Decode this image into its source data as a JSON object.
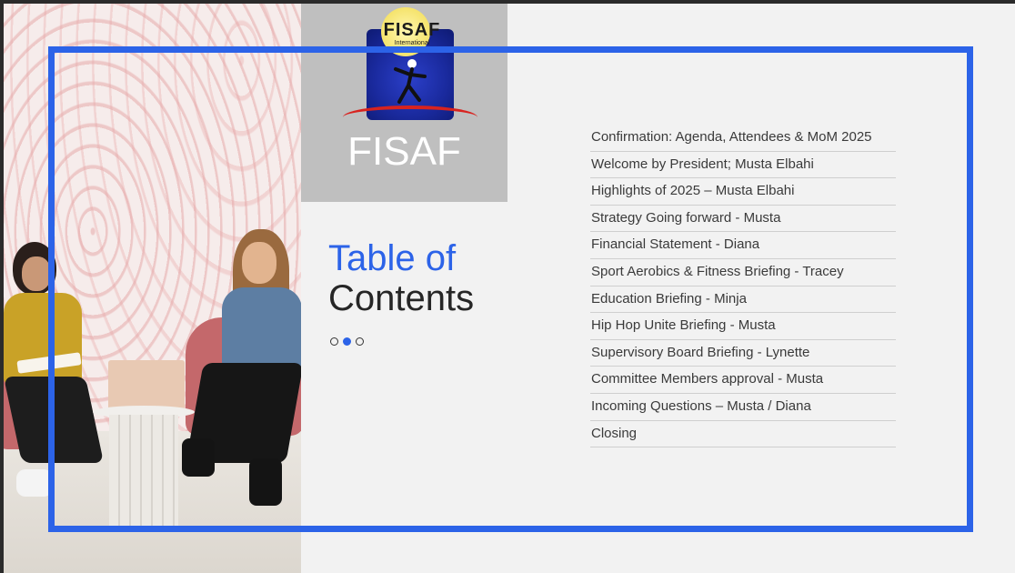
{
  "logo": {
    "emblem_text": "FISAF",
    "emblem_subtext": "International",
    "title": "FISAF",
    "colors": {
      "emblem_blue": "#1a2a9e",
      "sun": "#f5e36c",
      "swoosh": "#d8231f",
      "block_bg": "#bfbfbf"
    }
  },
  "heading": {
    "line1": "Table of",
    "line2": "Contents"
  },
  "pager": {
    "count": 3,
    "active_index": 1
  },
  "agenda": [
    "Confirmation: Agenda, Attendees & MoM 2025",
    "Welcome by President; Musta Elbahi",
    "Highlights of 2025 – Musta Elbahi",
    "Strategy Going forward - Musta",
    "Financial Statement - Diana",
    "Sport Aerobics & Fitness Briefing - Tracey",
    "Education Briefing - Minja",
    "Hip Hop Unite Briefing - Musta",
    "Supervisory Board Briefing - Lynette",
    "Committee Members approval - Musta",
    "Incoming Questions – Musta / Diana",
    "Closing"
  ],
  "colors": {
    "accent_blue": "#2c63e8",
    "slide_bg": "#f2f2f2"
  }
}
